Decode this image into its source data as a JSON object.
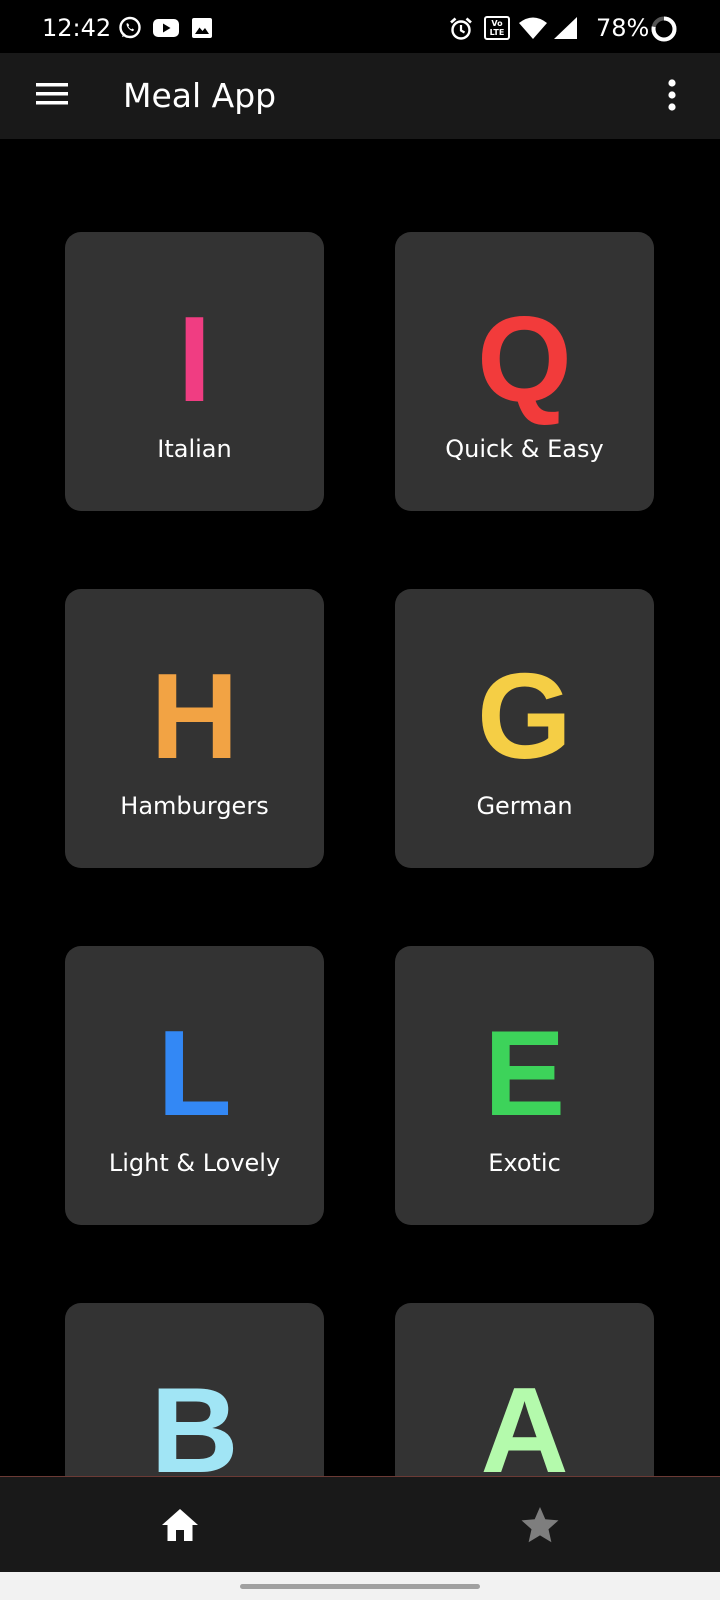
{
  "status_bar": {
    "time": "12:42",
    "battery_percent": "78%",
    "battery_level": 0.78,
    "left_icons": [
      "whatsapp-icon",
      "youtube-icon",
      "gallery-icon"
    ],
    "right_icons": [
      "alarm-icon",
      "volte-icon",
      "wifi-icon",
      "signal-icon",
      "battery-ring-icon"
    ]
  },
  "app_bar": {
    "title": "Meal App",
    "menu_icon": "hamburger-menu-icon",
    "overflow_icon": "more-vert-icon"
  },
  "categories": [
    {
      "letter": "I",
      "label": "Italian",
      "color": "#F03D82"
    },
    {
      "letter": "Q",
      "label": "Quick & Easy",
      "color": "#F23B3B"
    },
    {
      "letter": "H",
      "label": "Hamburgers",
      "color": "#F2A344"
    },
    {
      "letter": "G",
      "label": "German",
      "color": "#F5CE45"
    },
    {
      "letter": "L",
      "label": "Light & Lovely",
      "color": "#3388F5"
    },
    {
      "letter": "E",
      "label": "Exotic",
      "color": "#3DD35A"
    },
    {
      "letter": "B",
      "label": "",
      "color": "#A1E5F5"
    },
    {
      "letter": "A",
      "label": "",
      "color": "#B4FAAC"
    }
  ],
  "bottom_nav": {
    "items": [
      {
        "icon": "home-icon",
        "active": true
      },
      {
        "icon": "star-icon",
        "active": false
      }
    ],
    "active_color": "#FFFFFF",
    "inactive_color": "#7E7E7E"
  }
}
